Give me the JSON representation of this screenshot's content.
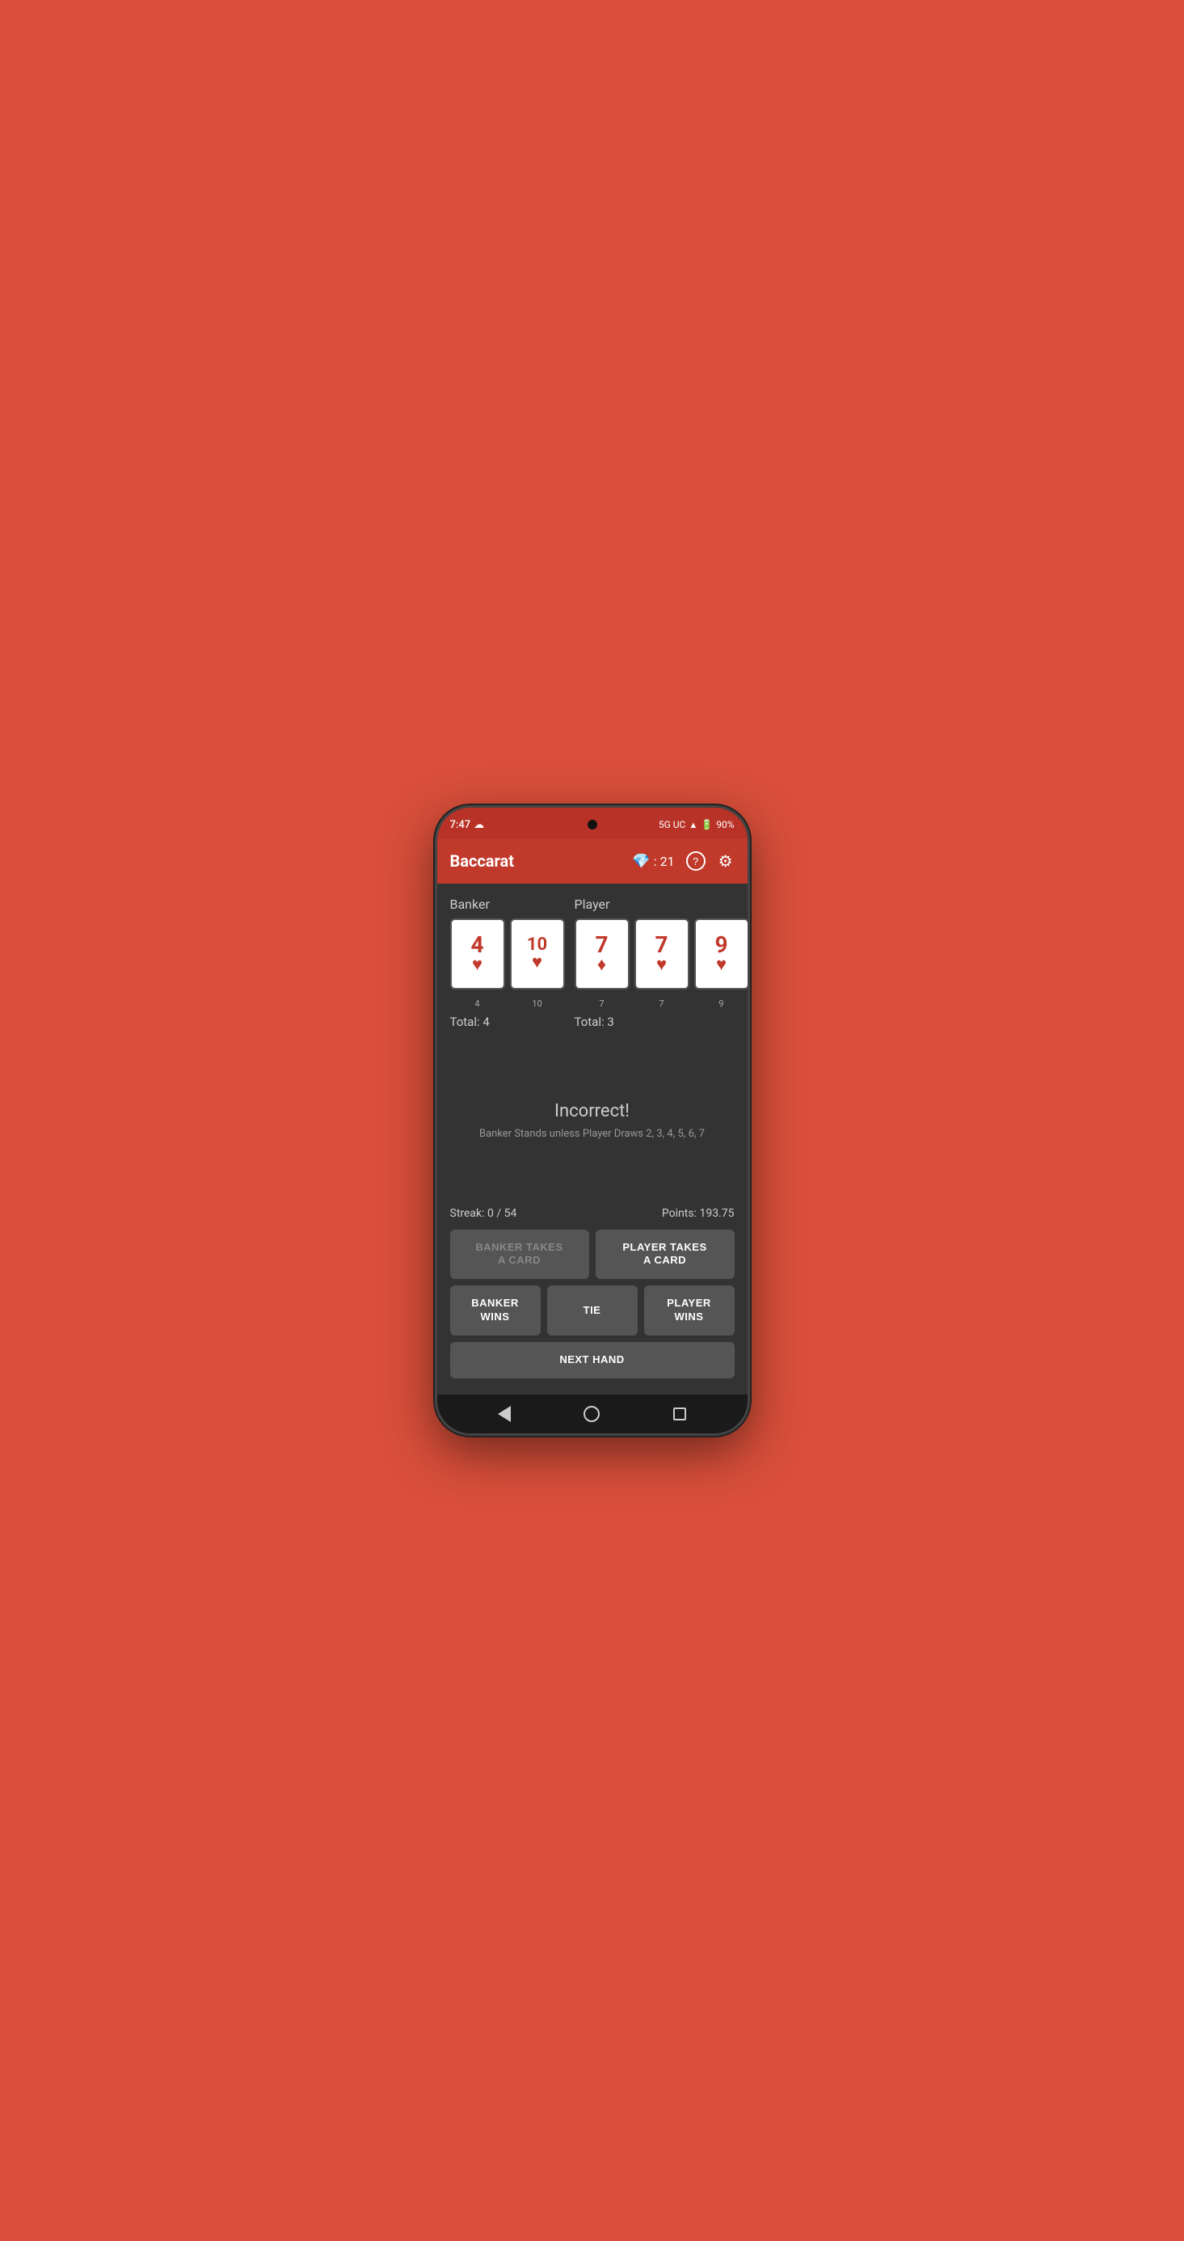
{
  "statusBar": {
    "time": "7:47",
    "network": "5G UC",
    "battery": "90%"
  },
  "appBar": {
    "title": "Baccarat",
    "gemScore": "21",
    "helpIcon": "?",
    "settingsIcon": "⚙"
  },
  "banker": {
    "label": "Banker",
    "cards": [
      {
        "value": "4",
        "suit": "♥",
        "label": "4"
      },
      {
        "value": "10",
        "suit": "♥",
        "label": "10"
      }
    ],
    "total": "Total: 4"
  },
  "player": {
    "label": "Player",
    "cards": [
      {
        "value": "7",
        "suit": "♦",
        "label": "7"
      },
      {
        "value": "7",
        "suit": "♥",
        "label": "7"
      },
      {
        "value": "9",
        "suit": "♥",
        "label": "9"
      }
    ],
    "total": "Total: 3"
  },
  "feedback": {
    "title": "Incorrect!",
    "detail": "Banker Stands unless Player Draws 2, 3, 4, 5, 6, 7"
  },
  "stats": {
    "streak": "Streak: 0 / 54",
    "points": "Points: 193.75"
  },
  "buttons": {
    "bankerTakesCard": "BANKER TAKES\nA CARD",
    "playerTakesCard": "PLAYER TAKES\nA CARD",
    "bankerWins": "BANKER\nWINS",
    "tie": "TIE",
    "playerWins": "PLAYER\nWINS",
    "nextHand": "NEXT HAND"
  }
}
